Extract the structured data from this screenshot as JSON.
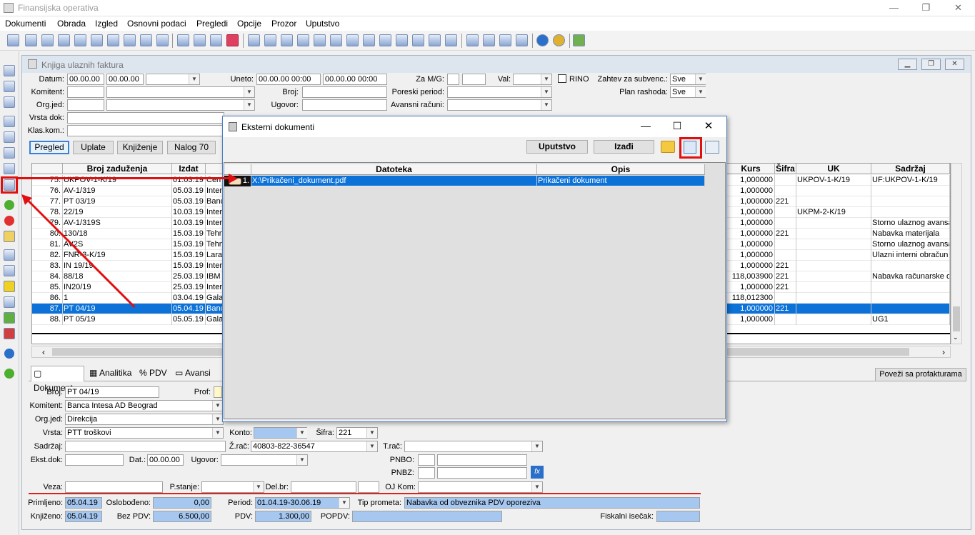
{
  "app": {
    "title": "Finansijska operativa"
  },
  "menu": [
    "Dokumenti",
    "Obrada",
    "Izgled",
    "Osnovni podaci",
    "Pregledi",
    "Opcije",
    "Prozor",
    "Uputstvo"
  ],
  "mdi": {
    "title": "Knjiga ulaznih faktura"
  },
  "filter": {
    "datum_label": "Datum:",
    "datum_from": "00.00.00",
    "datum_to": "00.00.00",
    "uneto_label": "Uneto:",
    "uneto_from": "00.00.00 00:00",
    "uneto_to": "00.00.00 00:00",
    "zamg_label": "Za M/G:",
    "val_label": "Val:",
    "rino_label": "RINO",
    "zahtev_label": "Zahtev za subvenc.:",
    "zahtev_value": "Sve",
    "plan_label": "Plan rashoda:",
    "plan_value": "Sve",
    "komitent_label": "Komitent:",
    "broj_label": "Broj:",
    "poreski_label": "Poreski period:",
    "orgjed_label": "Org.jed:",
    "ugovor_label": "Ugovor:",
    "avansni_label": "Avansni računi:",
    "vrstadok_label": "Vrsta dok:",
    "klaskom_label": "Klas.kom.:"
  },
  "view_buttons": [
    "Pregled",
    "Uplate",
    "Knjiženje",
    "Nalog 70"
  ],
  "grid": {
    "headers": {
      "broj": "Broj zaduženja",
      "izdat": "Izdat",
      "kurs": "Kurs",
      "sifra": "Šifra",
      "uk": "UK",
      "sadrzaj": "Sadržaj"
    },
    "rows": [
      {
        "n": "75.",
        "broj": "UKPOV-1-K/19",
        "izdat": "01.03.19",
        "kom": "Cen",
        "kurs": "1,000000",
        "sifra": "",
        "uk": "UKPOV-1-K/19",
        "sadrzaj": "UF:UKPOV-1-K/19"
      },
      {
        "n": "76.",
        "broj": "AV-1/319",
        "izdat": "05.03.19",
        "kom": "Inter",
        "kurs": "1,000000",
        "sifra": "",
        "uk": "",
        "sadrzaj": ""
      },
      {
        "n": "77.",
        "broj": "PT 03/19",
        "izdat": "05.03.19",
        "kom": "Banc",
        "kurs": "1,000000",
        "sifra": "221",
        "uk": "",
        "sadrzaj": ""
      },
      {
        "n": "78.",
        "broj": "22/19",
        "izdat": "10.03.19",
        "kom": "Inter",
        "kurs": "1,000000",
        "sifra": "",
        "uk": "UKPM-2-K/19",
        "sadrzaj": ""
      },
      {
        "n": "79.",
        "broj": "AV-1/319S",
        "izdat": "10.03.19",
        "kom": "Inter",
        "kurs": "1,000000",
        "sifra": "",
        "uk": "",
        "sadrzaj": "Storno ulaznog avansa"
      },
      {
        "n": "80.",
        "broj": "130/18",
        "izdat": "15.03.19",
        "kom": "Tehn",
        "kurs": "1,000000",
        "sifra": "221",
        "uk": "",
        "sadrzaj": "Nabavka materijala"
      },
      {
        "n": "81.",
        "broj": "AV2S",
        "izdat": "15.03.19",
        "kom": "Tehn",
        "kurs": "1,000000",
        "sifra": "",
        "uk": "",
        "sadrzaj": "Storno ulaznog avansa"
      },
      {
        "n": "82.",
        "broj": "FNR-3-K/19",
        "izdat": "15.03.19",
        "kom": "Lara",
        "kurs": "1,000000",
        "sifra": "",
        "uk": "",
        "sadrzaj": "Ulazni interni obračun P"
      },
      {
        "n": "83.",
        "broj": "IN 19/19",
        "izdat": "15.03.19",
        "kom": "Inter",
        "kurs": "1,000000",
        "sifra": "221",
        "uk": "",
        "sadrzaj": ""
      },
      {
        "n": "84.",
        "broj": "88/18",
        "izdat": "25.03.19",
        "kom": "IBM",
        "kurs": "118,003900",
        "sifra": "221",
        "uk": "",
        "sadrzaj": "Nabavka računarske op"
      },
      {
        "n": "85.",
        "broj": "IN20/19",
        "izdat": "25.03.19",
        "kom": "Inter",
        "kurs": "1,000000",
        "sifra": "221",
        "uk": "",
        "sadrzaj": ""
      },
      {
        "n": "86.",
        "broj": "1",
        "izdat": "03.04.19",
        "kom": "Gala",
        "kurs": "118,012300",
        "sifra": "",
        "uk": "",
        "sadrzaj": ""
      },
      {
        "n": "87.",
        "broj": "PT 04/19",
        "izdat": "05.04.19",
        "kom": "Banc",
        "kurs": "1,000000",
        "sifra": "221",
        "uk": "",
        "sadrzaj": ""
      },
      {
        "n": "88.",
        "broj": "PT 05/19",
        "izdat": "05.05.19",
        "kom": "Gala",
        "kurs": "1,000000",
        "sifra": "",
        "uk": "",
        "sadrzaj": "UG1"
      }
    ]
  },
  "bottom_tabs": [
    "Dokument",
    "Analitika",
    "PDV",
    "Avansi"
  ],
  "povezi_button": "Poveži sa profakturama",
  "detail": {
    "broj_label": "Broj:",
    "broj": "PT 04/19",
    "prof_label": "Prof:",
    "komitent_label": "Komitent:",
    "komitent": "Banca Intesa AD Beograd",
    "orgjed_label": "Org.jed:",
    "orgjed": "Direkcija",
    "vrsta_label": "Vrsta:",
    "vrsta": "PTT troškovi",
    "konto_label": "Konto:",
    "sifra_label": "Šifra:",
    "sifra": "221",
    "sadrzaj_label": "Sadržaj:",
    "zrac_label": "Ž.rač:",
    "zrac": "40803-822-36547",
    "trac_label": "T.rač:",
    "ekst_label": "Ekst.dok:",
    "dat_label": "Dat.:",
    "dat": "00.00.00",
    "ugovor_label": "Ugovor:",
    "pnbo_label": "PNBO:",
    "pnbz_label": "PNBZ:",
    "veza_label": "Veza:",
    "pstanje_label": "P.stanje:",
    "delbr_label": "Del.br:",
    "ojkom_label": "OJ Kom:",
    "primljeno_label": "Primljeno:",
    "primljeno": "05.04.19",
    "oslobodjeno_label": "Oslobođeno:",
    "oslobodjeno": "0,00",
    "period_label": "Period:",
    "period": "01.04.19-30.06.19",
    "tip_label": "Tip prometa:",
    "tip": "Nabavka od obveznika PDV oporeziva",
    "knjizeno_label": "Knjiženo:",
    "knjizeno": "05.04.19",
    "bezpdv_label": "Bez PDV:",
    "bezpdv": "6.500,00",
    "pdv_label": "PDV:",
    "pdv": "1.300,00",
    "popdv_label": "POPDV:",
    "fiskalni_label": "Fiskalni isečak:"
  },
  "dialog": {
    "title": "Eksterni dokumenti",
    "uputstvo": "Uputstvo",
    "izadji": "Izađi",
    "col_datoteka": "Datoteka",
    "col_opis": "Opis",
    "row": {
      "n": "1.",
      "datoteka": "X:\\Prikačeni_dokument.pdf",
      "opis": "Prikačeni dokument"
    }
  },
  "colors": {
    "selection": "#0c72d7",
    "highlight": "#e01010",
    "field_blue": "#a6c8f0"
  }
}
